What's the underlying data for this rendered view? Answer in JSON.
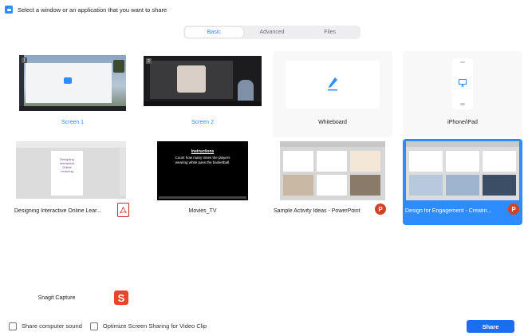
{
  "window": {
    "title": "Select a window or an application that you want to share"
  },
  "tabs": [
    {
      "label": "Basic",
      "active": true
    },
    {
      "label": "Advanced",
      "active": false
    },
    {
      "label": "Files",
      "active": false
    }
  ],
  "tiles": [
    {
      "label": "Screen 1",
      "screen_number": "1"
    },
    {
      "label": "Screen 2",
      "screen_number": "2"
    },
    {
      "label": "Whiteboard"
    },
    {
      "label": "iPhone/iPad"
    },
    {
      "label": "Designing Interactive Online Lear...",
      "thumb_text": [
        "Designing",
        "Interactive",
        "Online",
        "Learning"
      ],
      "app_icon": "pdf-icon"
    },
    {
      "label": "Movies_TV",
      "thumb_title": "Instructions",
      "thumb_text": "Count how many times the players wearing white pass the basketball."
    },
    {
      "label": "Sample Activity Ideas - PowerPoint",
      "badge": "P"
    },
    {
      "label": "Design for Engagement - Creatin...",
      "badge": "P",
      "selected": true
    },
    {
      "label": "Snagit Capture",
      "badge": "S"
    }
  ],
  "footer": {
    "share_sound_label": "Share computer sound",
    "optimize_label": "Optimize Screen Sharing for Video Clip",
    "share_button": "Share"
  },
  "colors": {
    "accent": "#2d8cff",
    "share_button": "#1d6df2",
    "powerpoint": "#d04423",
    "snagit": "#e8452c"
  }
}
